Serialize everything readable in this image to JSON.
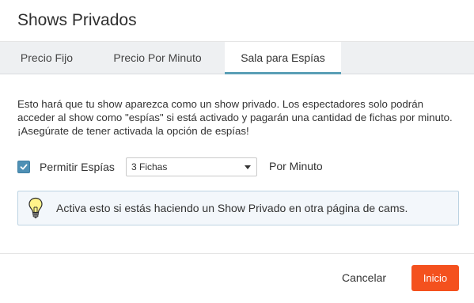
{
  "dialog": {
    "title": "Shows Privados"
  },
  "tabs": [
    {
      "label": "Precio Fijo"
    },
    {
      "label": "Precio Por Minuto"
    },
    {
      "label": "Sala para Espías",
      "active": true
    }
  ],
  "description": "Esto hará que tu show aparezca como un show privado. Los espectadores solo podrán acceder al show como \"espías\" si está activado y pagarán una cantidad de fichas por minuto. ¡Asegúrate de tener activada la opción de espías!",
  "spy_option": {
    "checked": true,
    "label": "Permitir Espías",
    "select_value": "3 Fichas",
    "suffix": "Por Minuto"
  },
  "info_box": {
    "icon": "lightbulb-icon",
    "text": "Activa esto si estás haciendo un Show Privado en otra página de cams."
  },
  "footer": {
    "cancel_label": "Cancelar",
    "start_label": "Inicio"
  },
  "colors": {
    "accent": "#5a9fb6",
    "checkbox": "#4e90b5",
    "primary_button": "#f4511e",
    "info_background": "#f3f7fb"
  }
}
